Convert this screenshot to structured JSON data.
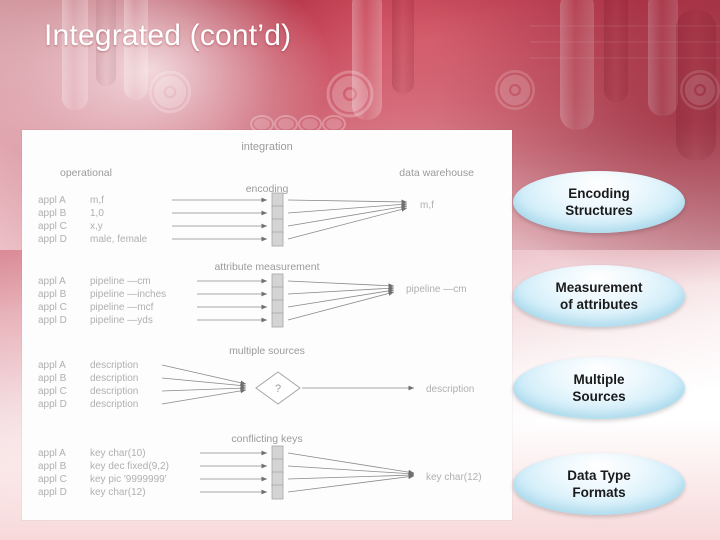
{
  "slide": {
    "title": "Integrated (cont’d)",
    "background_colors": {
      "accent_red": "#9d1d2e",
      "accent_pink": "#d1707f",
      "white": "#ffffff",
      "callout_fill": "#c6e9f7"
    }
  },
  "diagram": {
    "column_headers": {
      "left": "operational",
      "right": "data warehouse"
    },
    "groups": [
      {
        "name": "encoding",
        "heading": "encoding",
        "rows": [
          {
            "app": "appl A",
            "value": "m,f"
          },
          {
            "app": "appl B",
            "value": "1,0"
          },
          {
            "app": "appl C",
            "value": "x,y"
          },
          {
            "app": "appl D",
            "value": "male, female"
          }
        ],
        "output": "m,f"
      },
      {
        "name": "attribute-measurement",
        "heading": "attribute measurement",
        "rows": [
          {
            "app": "appl A",
            "value": "pipeline —cm"
          },
          {
            "app": "appl B",
            "value": "pipeline —inches"
          },
          {
            "app": "appl C",
            "value": "pipeline —mcf"
          },
          {
            "app": "appl D",
            "value": "pipeline —yds"
          }
        ],
        "output": "pipeline —cm"
      },
      {
        "name": "multiple-sources",
        "heading": "multiple sources",
        "rows": [
          {
            "app": "appl A",
            "value": "description"
          },
          {
            "app": "appl B",
            "value": "description"
          },
          {
            "app": "appl C",
            "value": "description"
          },
          {
            "app": "appl D",
            "value": "description"
          }
        ],
        "decision": "?",
        "output": "description"
      },
      {
        "name": "conflicting-keys",
        "heading": "conflicting keys",
        "rows": [
          {
            "app": "appl A",
            "value": "key   char(10)"
          },
          {
            "app": "appl B",
            "value": "key   dec fixed(9,2)"
          },
          {
            "app": "appl C",
            "value": "key   pic '9999999'"
          },
          {
            "app": "appl D",
            "value": "key   char(12)"
          }
        ],
        "output": "key   char(12)"
      }
    ],
    "top_label": "integration"
  },
  "callouts": [
    {
      "line1": "Encoding",
      "line2": "Structures"
    },
    {
      "line1": "Measurement",
      "line2": "of attributes"
    },
    {
      "line1": "Multiple",
      "line2": "Sources"
    },
    {
      "line1": "Data Type",
      "line2": "Formats"
    }
  ]
}
